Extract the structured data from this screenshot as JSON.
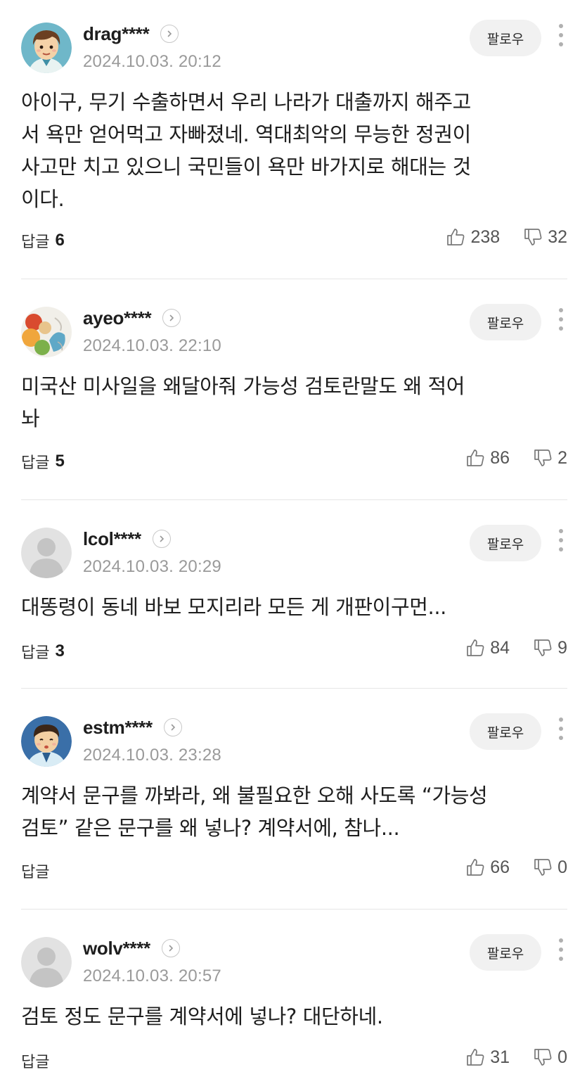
{
  "ui": {
    "follow_label": "팔로우",
    "reply_label": "답글"
  },
  "comments": [
    {
      "nickname": "drag****",
      "date": "2024.10.03. 20:12",
      "avatar": "cartoon-boy-avatar",
      "body_lines": [
        "아이구, 무기 수출하면서 우리 나라가 대출까지 해주고",
        "서 욕만 얻어먹고 자빠졌네. 역대최악의 무능한 정권이",
        "사고만 치고 있으니 국민들이 욕만 바가지로 해대는 것",
        "이다."
      ],
      "reply_count": "6",
      "likes": "238",
      "dislikes": "32"
    },
    {
      "nickname": "ayeo****",
      "date": "2024.10.03. 22:10",
      "avatar": "food-photo-avatar",
      "body_lines": [
        "미국산 미사일을 왜달아줘 가능성 검토란말도 왜 적어",
        "놔"
      ],
      "reply_count": "5",
      "likes": "86",
      "dislikes": "2"
    },
    {
      "nickname": "lcol****",
      "date": "2024.10.03. 20:29",
      "avatar": "default-user-avatar",
      "body_lines": [
        "대똥령이 동네 바보 모지리라 모든 게 개판이구먼..."
      ],
      "reply_count": "3",
      "likes": "84",
      "dislikes": "9"
    },
    {
      "nickname": "estm****",
      "date": "2024.10.03. 23:28",
      "avatar": "cartoon-man-avatar",
      "body_lines": [
        "계약서 문구를 까봐라, 왜 불필요한 오해 사도록 “가능성",
        "검토” 같은 문구를 왜 넣나? 계약서에, 참나..."
      ],
      "reply_count": "",
      "likes": "66",
      "dislikes": "0"
    },
    {
      "nickname": "wolv****",
      "date": "2024.10.03. 20:57",
      "avatar": "default-user-avatar",
      "body_lines": [
        "검토 정도 문구를 계약서에 넣나? 대단하네."
      ],
      "reply_count": "",
      "likes": "31",
      "dislikes": "0"
    }
  ]
}
